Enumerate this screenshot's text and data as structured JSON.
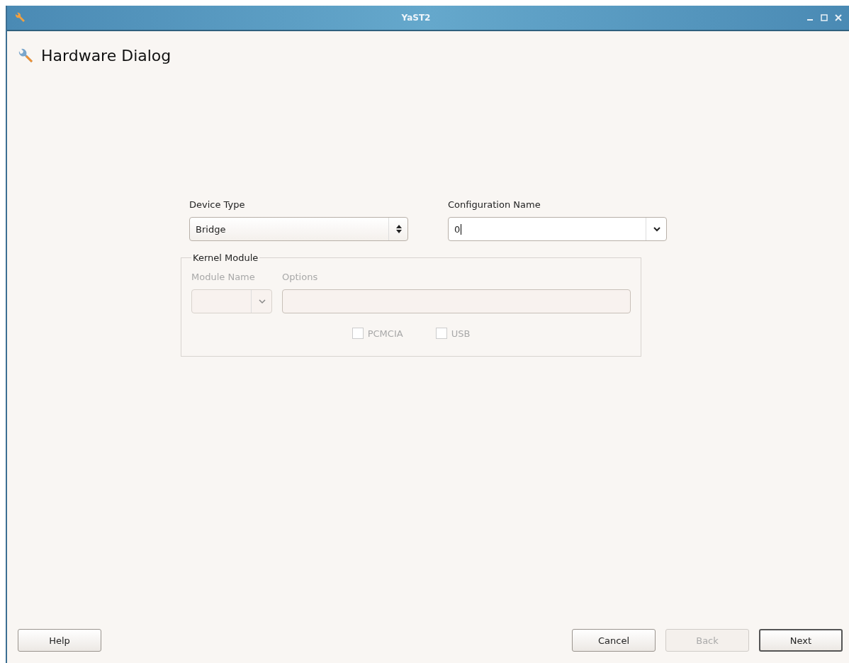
{
  "window": {
    "title": "YaST2"
  },
  "dialog": {
    "title": "Hardware Dialog"
  },
  "device_type": {
    "label": "Device Type",
    "value": "Bridge"
  },
  "configuration_name": {
    "label": "Configuration Name",
    "value": "0"
  },
  "kernel_module": {
    "title": "Kernel Module",
    "disabled": true,
    "module_name": {
      "label": "Module Name",
      "disabled": true
    },
    "options": {
      "label": "Options",
      "disabled": true
    },
    "checkboxes": [
      {
        "label": "PCMCIA",
        "checked": false,
        "disabled": true
      },
      {
        "label": "USB",
        "checked": false,
        "disabled": true
      }
    ]
  },
  "buttons": [
    {
      "label": "Help",
      "kind": "left",
      "disabled": false,
      "default": false
    },
    {
      "label": "Cancel",
      "kind": "right",
      "disabled": false,
      "default": false
    },
    {
      "label": "Back",
      "kind": "right",
      "disabled": true,
      "default": false
    },
    {
      "label": "Next",
      "kind": "right",
      "disabled": false,
      "default": true
    }
  ]
}
